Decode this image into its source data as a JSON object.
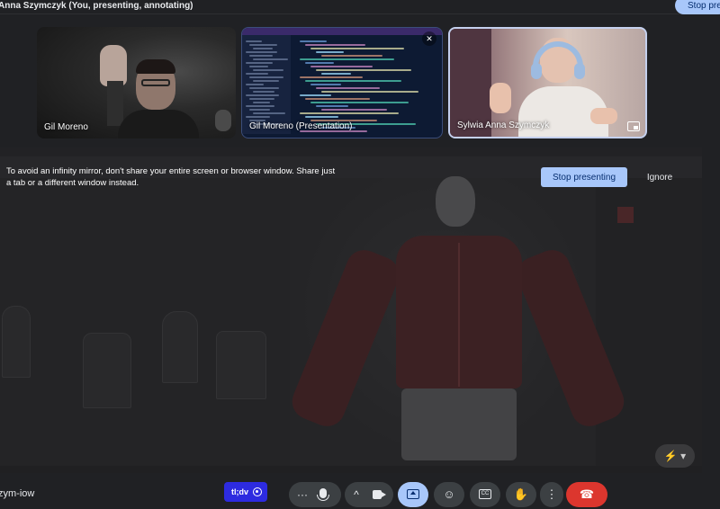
{
  "top_bar": {
    "presenter_text": "Anna Szymczyk (You, presenting, annotating)",
    "stop_label": "Stop presenting"
  },
  "tiles": [
    {
      "name": "Gil Moreno"
    },
    {
      "name": "Gil Moreno (Presentation)"
    },
    {
      "name": "Sylwia Anna Szymczyk"
    }
  ],
  "warning": {
    "message": "To avoid an infinity mirror, don't share your entire screen or browser window. Share just a tab or a different window instead.",
    "stop_label": "Stop presenting",
    "ignore_label": "Ignore"
  },
  "bottom_bar": {
    "meeting_code": "zym-iow",
    "tldv_label": "tl;dv",
    "more_options_glyph": "···",
    "expand_glyph": "^",
    "more_vert_glyph": "⋮",
    "fab_glyph": "⚡ ▾"
  },
  "icons": {
    "more": "more-horiz-icon",
    "mic": "mic-icon",
    "expand": "chevron-up-icon",
    "camera": "videocam-icon",
    "present": "present-screen-icon",
    "emoji": "emoji-icon",
    "captions": "closed-captions-icon",
    "hand": "raise-hand-icon",
    "more_vert": "more-vert-icon",
    "end_call": "call-end-icon"
  },
  "colors": {
    "background": "#202124",
    "accent": "#a8c7fa",
    "end_call": "#dc362e",
    "tldv": "#2d2be0",
    "garment": "#5e2222"
  }
}
